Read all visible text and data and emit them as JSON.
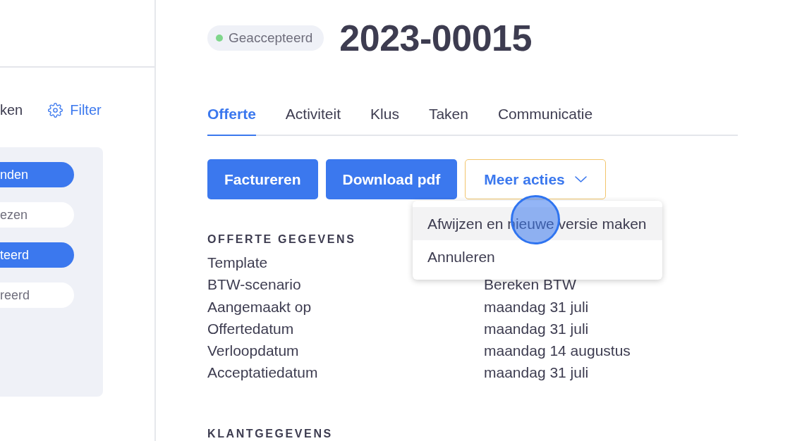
{
  "sidebar": {
    "toolbar_label": "ken",
    "filter_button": "Filter",
    "status_filters": [
      {
        "label": "nden",
        "selected": true
      },
      {
        "label": "ezen",
        "selected": false
      },
      {
        "label": "teerd",
        "selected": true
      },
      {
        "label": "reerd",
        "selected": false
      }
    ]
  },
  "header": {
    "status_badge": "Geaccepteerd",
    "title": "2023-00015"
  },
  "tabs": [
    {
      "label": "Offerte",
      "selected": true
    },
    {
      "label": "Activiteit",
      "selected": false
    },
    {
      "label": "Klus",
      "selected": false
    },
    {
      "label": "Taken",
      "selected": false
    },
    {
      "label": "Communicatie",
      "selected": false
    }
  ],
  "actions": [
    {
      "kind": "primary",
      "label": "Factureren"
    },
    {
      "kind": "primary",
      "label": "Download pdf"
    },
    {
      "kind": "dropdown",
      "label": "Meer acties",
      "expanded": true,
      "menu": [
        {
          "label": "Afwijzen en nieuwe versie maken",
          "hovered": true
        },
        {
          "label": "Annuleren",
          "hovered": false
        }
      ]
    }
  ],
  "sections": [
    {
      "title": "OFFERTE GEGEVENS",
      "rows": [
        {
          "label": "Template"
        },
        {
          "label": "BTW-scenario",
          "value": "Bereken BTW"
        },
        {
          "label": "Aangemaakt op",
          "value": "maandag 31 juli"
        },
        {
          "label": "Offertedatum",
          "value": "maandag 31 juli"
        },
        {
          "label": "Verloopdatum",
          "value": "maandag 14 augustus"
        },
        {
          "label": "Acceptatiedatum",
          "value": "maandag 31 juli"
        }
      ]
    },
    {
      "title": "KLANTGEGEVENS"
    }
  ]
}
